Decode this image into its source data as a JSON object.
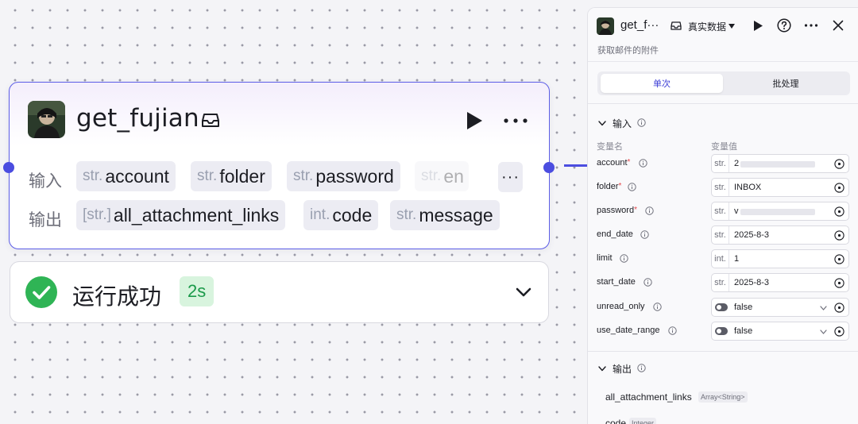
{
  "node": {
    "title": "get_fujian",
    "input_label": "输入",
    "output_label": "输出",
    "inputs": [
      {
        "type": "str.",
        "name": "account"
      },
      {
        "type": "str.",
        "name": "folder"
      },
      {
        "type": "str.",
        "name": "password"
      },
      {
        "type": "str.",
        "name": "en"
      }
    ],
    "outputs": [
      {
        "type": "[str.]",
        "name": "all_attachment_links"
      },
      {
        "type": "int.",
        "name": "code"
      },
      {
        "type": "str.",
        "name": "message"
      }
    ],
    "more_label": "···"
  },
  "result": {
    "status_text": "运行成功",
    "duration": "2s",
    "status_color": "#2fb455"
  },
  "panel": {
    "title": "get_f···",
    "mode_label": "真实数据",
    "subtitle": "获取邮件的附件",
    "tabs": [
      "单次",
      "批处理"
    ],
    "input_section": "输入",
    "col_name": "变量名",
    "col_value": "变量值",
    "params": [
      {
        "name": "account",
        "required": true,
        "type": "str.",
        "value": "2",
        "masked": true
      },
      {
        "name": "folder",
        "required": true,
        "type": "str.",
        "value": "INBOX"
      },
      {
        "name": "password",
        "required": true,
        "type": "str.",
        "value": "v",
        "masked": true
      },
      {
        "name": "end_date",
        "required": false,
        "type": "str.",
        "value": "2025-8-3"
      },
      {
        "name": "limit",
        "required": false,
        "type": "int.",
        "value": "1"
      },
      {
        "name": "start_date",
        "required": false,
        "type": "str.",
        "value": "2025-8-3"
      },
      {
        "name": "unread_only",
        "required": false,
        "type": "toggle",
        "value": "false"
      },
      {
        "name": "use_date_range",
        "required": false,
        "type": "toggle",
        "value": "false"
      }
    ],
    "output_section": "输出",
    "outputs": [
      {
        "name": "all_attachment_links",
        "type": "Array<String>"
      },
      {
        "name": "code",
        "type": "Integer"
      }
    ]
  },
  "colors": {
    "accent": "#5b5ce6",
    "port": "#4b4de0",
    "success": "#2fb455",
    "required": "#e5484d"
  }
}
